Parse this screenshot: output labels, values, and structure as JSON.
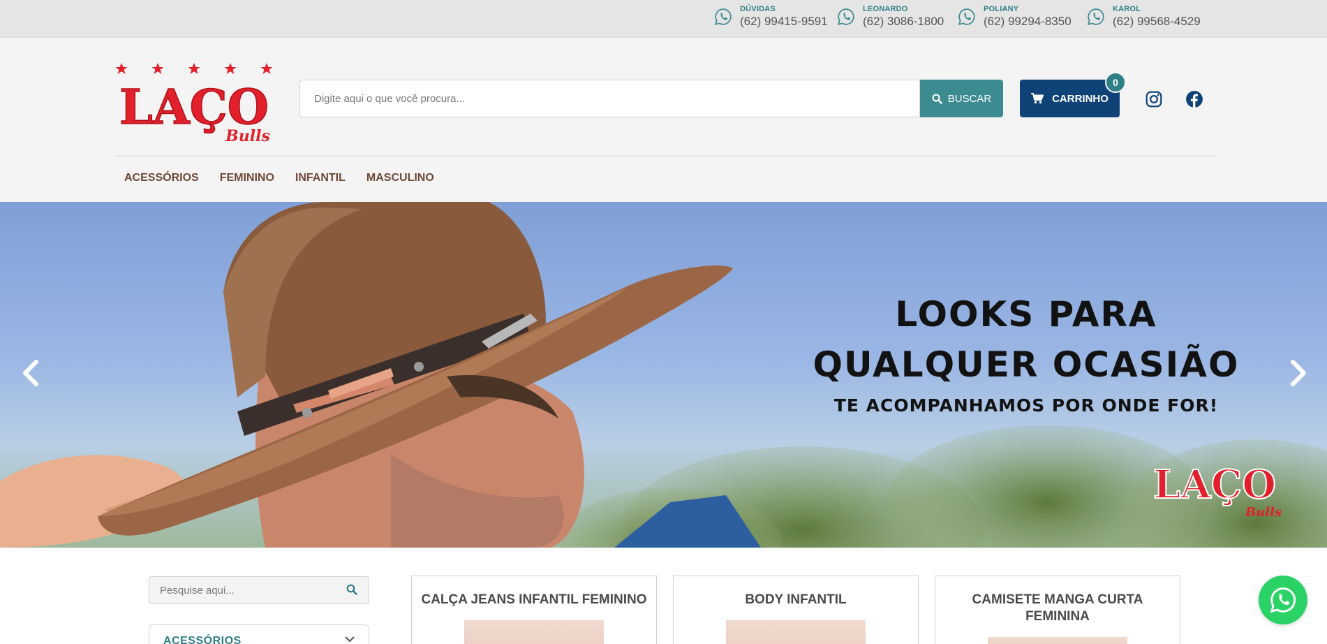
{
  "topbar": {
    "contacts": [
      {
        "name": "DÚVIDAS",
        "phone": "(62) 99415-9591"
      },
      {
        "name": "LEONARDO",
        "phone": "(62) 3086-1800"
      },
      {
        "name": "POLIANY",
        "phone": "(62) 99294-8350"
      },
      {
        "name": "KAROL",
        "phone": "(62) 99568-4529"
      }
    ]
  },
  "header": {
    "logo": {
      "text": "LAÇO",
      "script": "Bulls"
    },
    "search": {
      "placeholder": "Digite aqui o que você procura...",
      "button_label": "BUSCAR"
    },
    "cart": {
      "label": "CARRINHO",
      "count": "0"
    },
    "social": [
      "instagram-icon",
      "facebook-icon"
    ],
    "nav": [
      "ACESSÓRIOS",
      "FEMININO",
      "INFANTIL",
      "MASCULINO"
    ]
  },
  "hero": {
    "headline_line1": "LOOKS PARA",
    "headline_line2": "QUALQUER OCASIÃO",
    "subheadline": "TE ACOMPANHAMOS POR ONDE FOR!",
    "logo": {
      "text": "LAÇO",
      "script": "Bulls"
    }
  },
  "sidebar": {
    "search_placeholder": "Pesquise aqui...",
    "category": "ACESSÓRIOS"
  },
  "products": [
    {
      "title": "CALÇA JEANS INFANTIL FEMININO"
    },
    {
      "title": "BODY INFANTIL"
    },
    {
      "title": "CAMISETE MANGA CURTA FEMININA"
    }
  ],
  "colors": {
    "teal": "#3c8b91",
    "navy": "#0f4377",
    "brand_red": "#e2202b",
    "nav_brown": "#6e4a36",
    "whatsapp_green": "#2bd366"
  }
}
